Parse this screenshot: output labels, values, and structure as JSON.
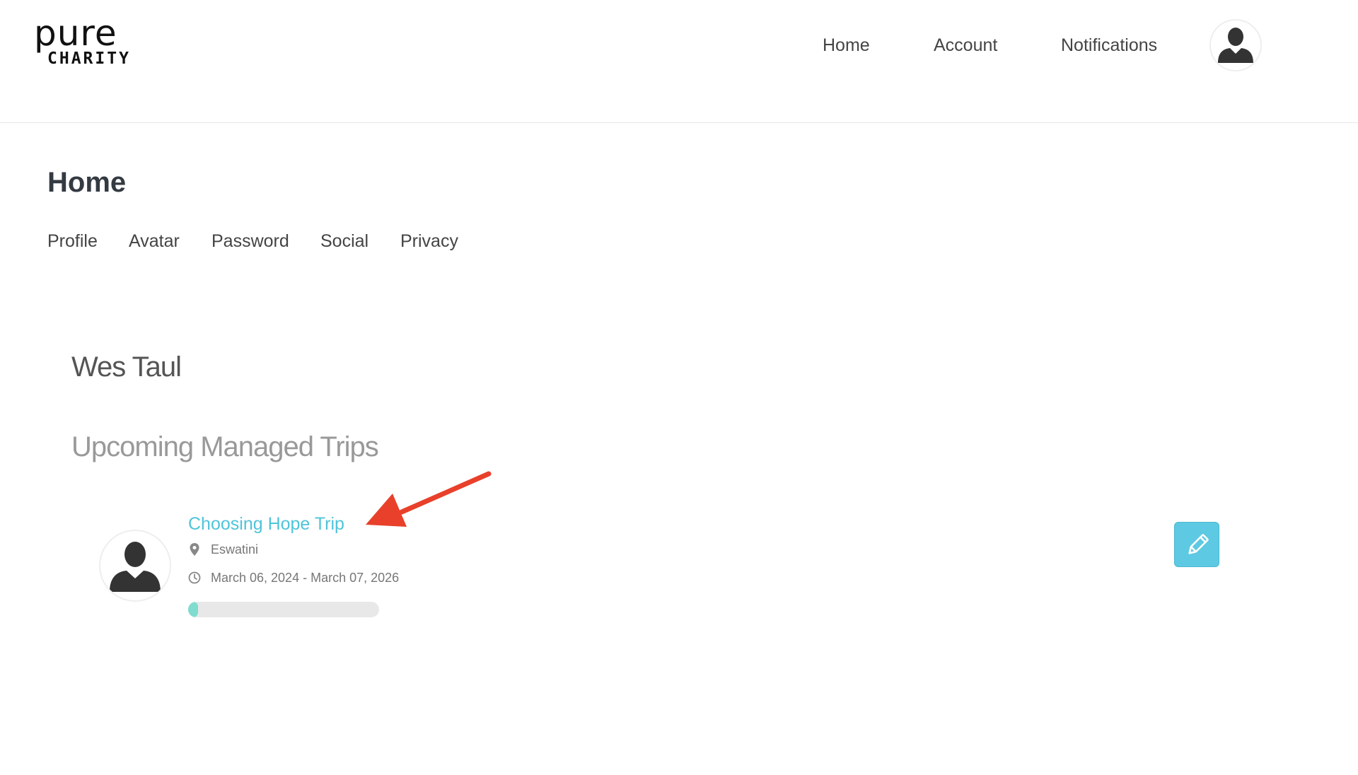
{
  "logo": {
    "top": "pure",
    "bottom": "CHARITY"
  },
  "header": {
    "nav": [
      {
        "label": "Home"
      },
      {
        "label": "Account"
      },
      {
        "label": "Notifications"
      }
    ],
    "avatar_icon": "user-silhouette-icon"
  },
  "page": {
    "title": "Home",
    "subnav": [
      {
        "label": "Profile"
      },
      {
        "label": "Avatar"
      },
      {
        "label": "Password"
      },
      {
        "label": "Social"
      },
      {
        "label": "Privacy"
      }
    ]
  },
  "profile": {
    "name": "Wes Taul"
  },
  "trips_section": {
    "title": "Upcoming Managed Trips",
    "trips": [
      {
        "title": "Choosing Hope Trip",
        "location": "Eswatini",
        "dates": "March 06, 2024 - March 07, 2026",
        "progress_percent": 5,
        "avatar_icon": "user-silhouette-icon",
        "edit_icon": "pencil-icon"
      }
    ]
  },
  "annotation": {
    "arrow_color": "#e8402a",
    "arrow_icon": "arrow-annotation-icon"
  },
  "colors": {
    "link": "#4fc4d9",
    "edit_button": "#5dc9e2",
    "progress_fill": "#7fdccf",
    "progress_track": "#e8e8e8"
  }
}
